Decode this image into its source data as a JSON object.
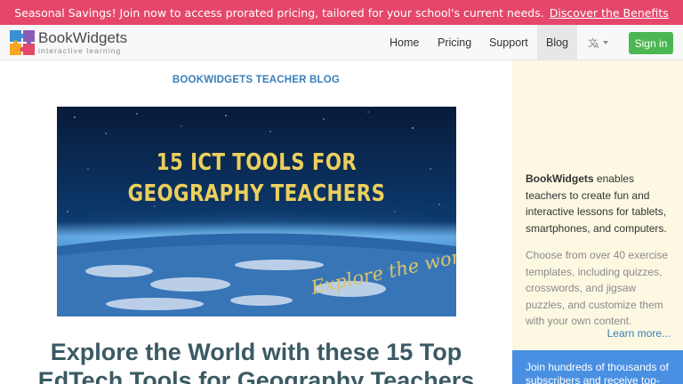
{
  "banner": {
    "text": "Seasonal Savings! Join now to access prorated pricing, tailored for your school's current needs.",
    "link": "Discover the Benefits"
  },
  "navbar": {
    "logo_name": "BookWidgets",
    "logo_tagline": "interactive learning",
    "items": [
      {
        "label": "Home"
      },
      {
        "label": "Pricing"
      },
      {
        "label": "Support"
      },
      {
        "label": "Blog",
        "active": true
      }
    ],
    "language_icon": "translate-icon",
    "signin": "Sign in"
  },
  "article": {
    "category": "BOOKWIDGETS TEACHER BLOG",
    "hero_title": "15 ICT TOOLS FOR GEOGRAPHY TEACHERS",
    "hero_tagline": "Explore the world!",
    "headline": "Explore the World with these 15 Top EdTech Tools for Geography Teachers"
  },
  "sidebar": {
    "brand": "BookWidgets",
    "intro": "enables teachers to create fun and interactive lessons for tablets, smartphones, and computers.",
    "description": "Choose from over 40 exercise templates, including quizzes, crosswords, and jigsaw puzzles, and customize them with your own content.",
    "learn_more": "Learn more...",
    "subscribe": "Join hundreds of thousands of subscribers and receive top-"
  },
  "colors": {
    "banner": "#e5476b",
    "signin": "#4cb652",
    "link": "#3b7fb8",
    "headline": "#3a5a63",
    "sidebar_bg": "#fdf8e2",
    "subscribe_bg": "#4a90e2"
  }
}
